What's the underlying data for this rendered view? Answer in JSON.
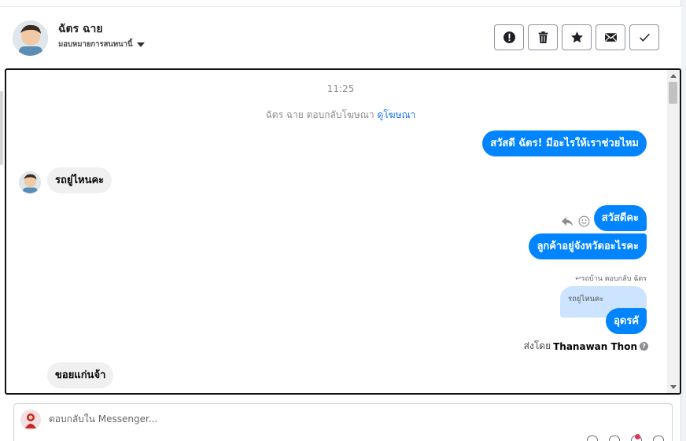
{
  "header": {
    "contact_name": "ฉัตร ฉาย",
    "assign_label": "มอบหมายการสนทนานี้"
  },
  "actions": [
    {
      "name": "mark-spam-button",
      "icon": "alert-icon"
    },
    {
      "name": "delete-button",
      "icon": "trash-icon"
    },
    {
      "name": "star-button",
      "icon": "star-icon"
    },
    {
      "name": "mark-unread-button",
      "icon": "envelope-icon"
    },
    {
      "name": "mark-done-button",
      "icon": "check-icon"
    }
  ],
  "thread": {
    "timestamp": "11:25",
    "ad_reply_text": "ฉัตร ฉาย ตอบกลับโฆษณา",
    "ad_link": "ดูโฆษณา",
    "messages": {
      "m1": "สวัสดี ฉัตร! มีอะไรให้เราช่วยไหม",
      "m2": "รถยู่ไหนคะ",
      "m3": "สวัสดีคะ",
      "m4": "ลูกค้าอยู่จังหวัดอะไรคะ",
      "reply_note": "รถบ้าน ตอบกลับ ฉัตร",
      "quoted": "รถยู่ไหนคะ",
      "m6": "อุดรคั",
      "m7": "ขอยแก่นจ้า"
    },
    "sent_by_prefix": "ส่งโดย",
    "sent_by_name": "Thanawan Thon"
  },
  "composer": {
    "placeholder": "ตอบกลับใน Messenger..."
  },
  "colors": {
    "outgoing": "#0084ff",
    "incoming": "#f0f0f0",
    "link": "#1877f2"
  }
}
